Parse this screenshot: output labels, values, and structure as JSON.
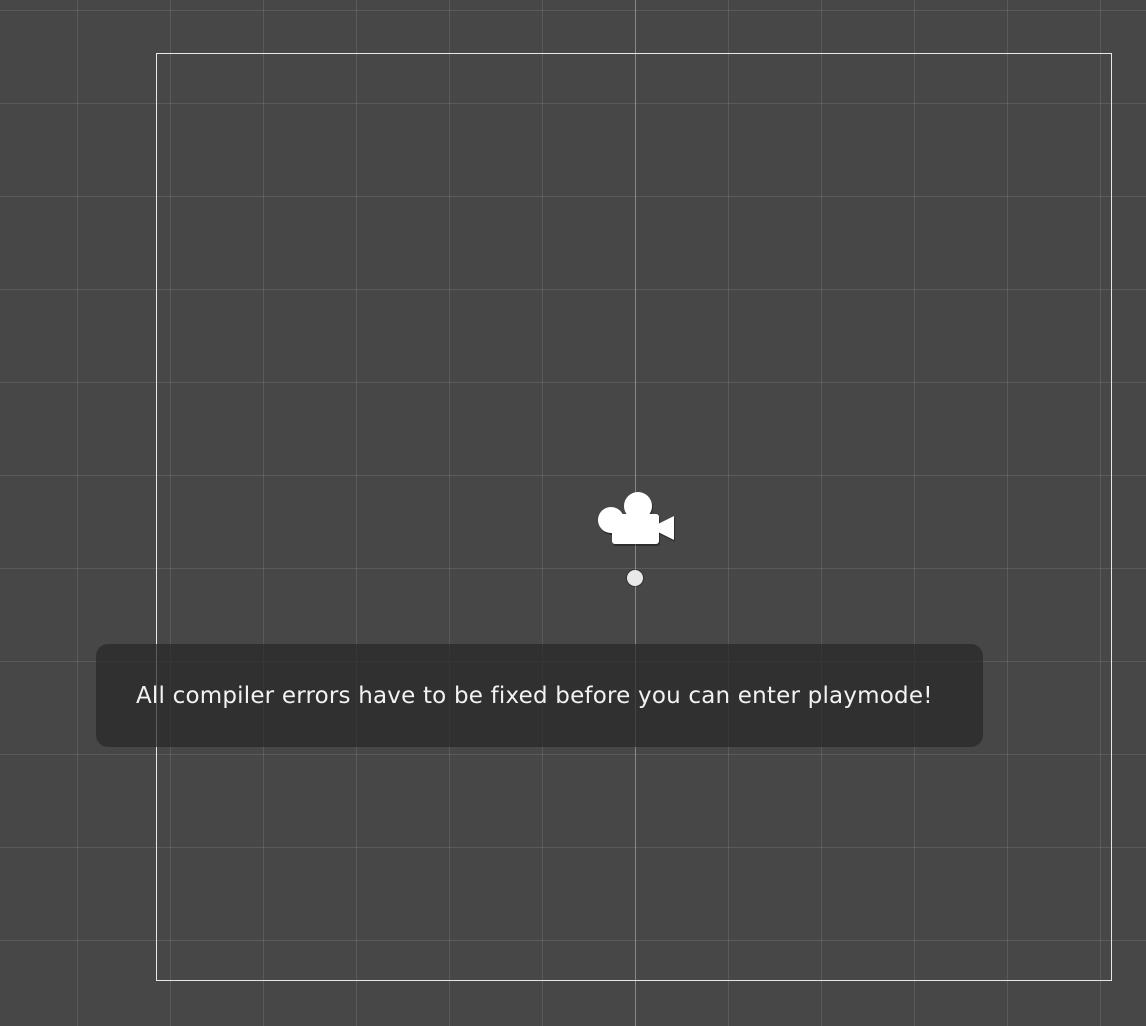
{
  "scene_view": {
    "background_color": "#474747",
    "frame_color": "#e6e6e6",
    "gizmo_color": "#ffffff",
    "icons": {
      "camera": "camera-gizmo-icon",
      "pivot": "pivot-dot-icon"
    }
  },
  "notification": {
    "message": "All compiler errors have to be fixed before you can enter playmode!"
  }
}
